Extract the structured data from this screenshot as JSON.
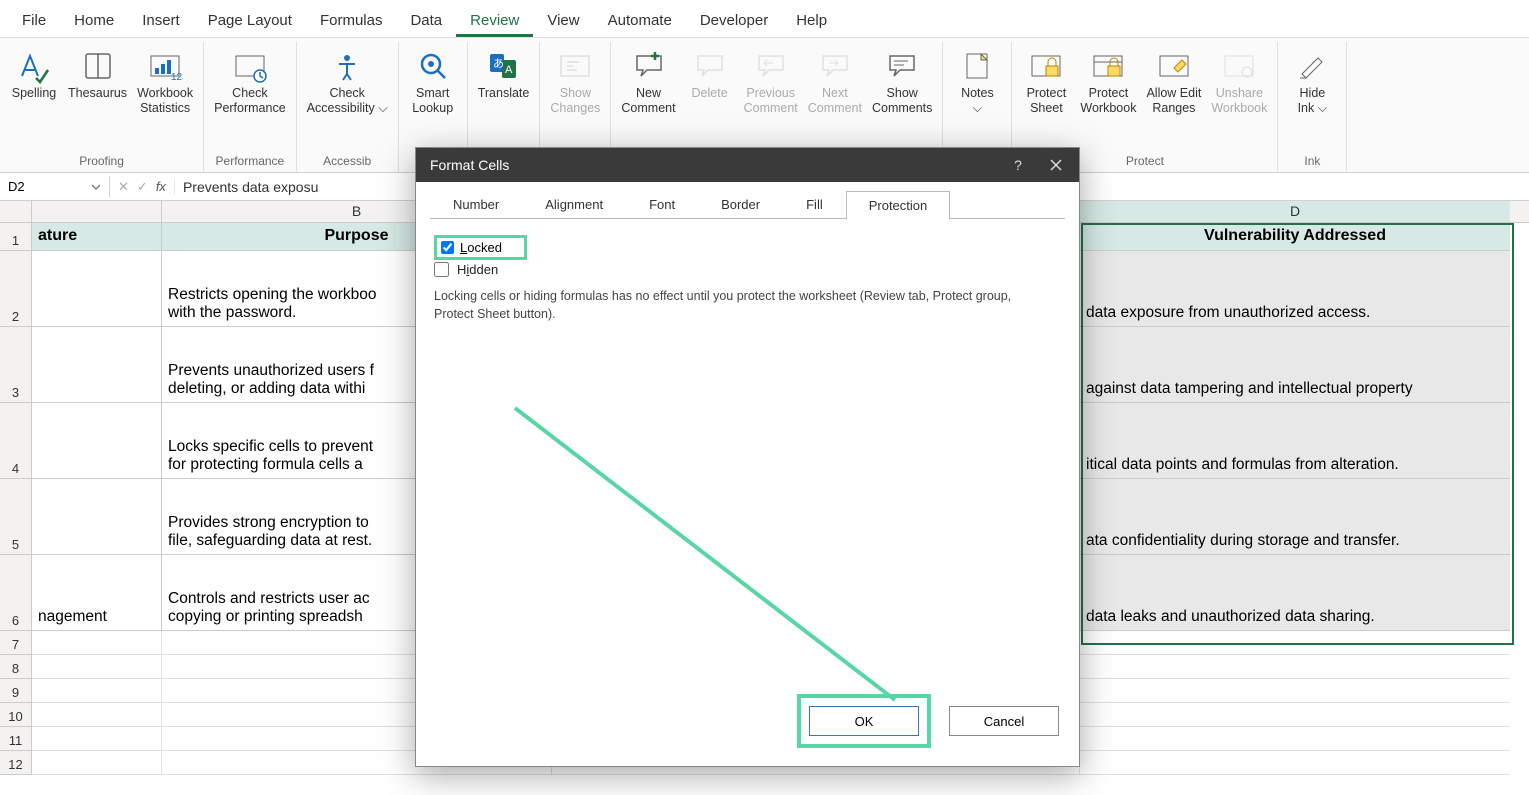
{
  "menu": {
    "items": [
      "File",
      "Home",
      "Insert",
      "Page Layout",
      "Formulas",
      "Data",
      "Review",
      "View",
      "Automate",
      "Developer",
      "Help"
    ],
    "active": "Review"
  },
  "ribbon": {
    "groups": [
      {
        "label": "Proofing",
        "buttons": [
          {
            "name": "spelling",
            "label": "Spelling"
          },
          {
            "name": "thesaurus",
            "label": "Thesaurus"
          },
          {
            "name": "workbook-statistics",
            "label": "Workbook\nStatistics"
          }
        ]
      },
      {
        "label": "Performance",
        "buttons": [
          {
            "name": "check-performance",
            "label": "Check\nPerformance"
          }
        ]
      },
      {
        "label": "Accessib",
        "buttons": [
          {
            "name": "check-accessibility",
            "label": "Check\nAccessibility ⌵"
          }
        ]
      },
      {
        "label": "",
        "buttons": [
          {
            "name": "smart-lookup",
            "label": "Smart\nLookup"
          }
        ]
      },
      {
        "label": "",
        "buttons": [
          {
            "name": "translate",
            "label": "Translate"
          }
        ]
      },
      {
        "label": "",
        "buttons": [
          {
            "name": "show-changes",
            "label": "Show\nChanges",
            "disabled": true
          }
        ]
      },
      {
        "label": "",
        "buttons": [
          {
            "name": "new-comment",
            "label": "New\nComment"
          },
          {
            "name": "delete-comment",
            "label": "Delete",
            "disabled": true
          },
          {
            "name": "previous-comment",
            "label": "Previous\nComment",
            "disabled": true
          },
          {
            "name": "next-comment",
            "label": "Next\nComment",
            "disabled": true
          },
          {
            "name": "show-comments",
            "label": "Show\nComments"
          }
        ]
      },
      {
        "label": "Notes",
        "buttons": [
          {
            "name": "notes",
            "label": "Notes\n⌵"
          }
        ]
      },
      {
        "label": "Protect",
        "buttons": [
          {
            "name": "protect-sheet",
            "label": "Protect\nSheet"
          },
          {
            "name": "protect-workbook",
            "label": "Protect\nWorkbook"
          },
          {
            "name": "allow-edit-ranges",
            "label": "Allow Edit\nRanges"
          },
          {
            "name": "unshare-workbook",
            "label": "Unshare\nWorkbook",
            "disabled": true
          }
        ]
      },
      {
        "label": "Ink",
        "buttons": [
          {
            "name": "hide-ink",
            "label": "Hide\nInk ⌵"
          }
        ]
      }
    ]
  },
  "formula_bar": {
    "name_box": "D2",
    "formula": "Prevents data exposu"
  },
  "sheet": {
    "columns": {
      "B": "B",
      "D": "D"
    },
    "header_row": {
      "A": "ature",
      "B": "Purpose",
      "D": "Vulnerability Addressed"
    },
    "rows": [
      {
        "n": 2,
        "A": "",
        "B": "Restricts opening the workboo\nwith the password.",
        "D": "data exposure from unauthorized access."
      },
      {
        "n": 3,
        "A": "",
        "B": "Prevents unauthorized users f\ndeleting, or adding data withi",
        "D": "against data tampering and intellectual property"
      },
      {
        "n": 4,
        "A": "",
        "B": "Locks specific cells to prevent\nfor protecting formula cells a",
        "D": "itical data points and formulas from alteration."
      },
      {
        "n": 5,
        "A": "",
        "B": "Provides strong encryption to\nfile, safeguarding data at rest.",
        "D": "ata confidentiality during storage and transfer."
      },
      {
        "n": 6,
        "A": "nagement",
        "B": "Controls and restricts user ac\ncopying or printing spreadsh",
        "D": "data leaks and unauthorized data sharing."
      }
    ],
    "empty_rows": [
      7,
      8,
      9,
      10,
      11,
      12
    ]
  },
  "dialog": {
    "title": "Format Cells",
    "tabs": [
      "Number",
      "Alignment",
      "Font",
      "Border",
      "Fill",
      "Protection"
    ],
    "active_tab": "Protection",
    "locked_label": "Locked",
    "hidden_label": "Hidden",
    "locked_checked": true,
    "hidden_checked": false,
    "hint": "Locking cells or hiding formulas has no effect until you protect the worksheet (Review tab, Protect group, Protect Sheet button).",
    "ok": "OK",
    "cancel": "Cancel"
  }
}
